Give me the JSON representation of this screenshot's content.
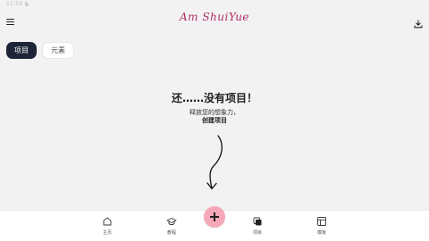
{
  "status": {
    "time": "11:59 5"
  },
  "app": {
    "title": "Am ShuiYue"
  },
  "tabs": [
    {
      "label": "项目",
      "active": true
    },
    {
      "label": "元素",
      "active": false
    }
  ],
  "empty": {
    "title": "还……没有项目！",
    "line1": "释放您的想象力，",
    "line2": "创建项目"
  },
  "bottom_nav": [
    {
      "label": "主页",
      "icon": "home-icon"
    },
    {
      "label": "教程",
      "icon": "graduation-cap-icon"
    },
    {
      "label": "项目",
      "icon": "project-stack-icon"
    },
    {
      "label": "模板",
      "icon": "template-icon"
    }
  ],
  "fab": {
    "icon": "plus-icon",
    "color": "#f6a8b8"
  },
  "colors": {
    "accent": "#b02e68",
    "active_tab": "#1f2538",
    "background": "#f2f2f2"
  }
}
